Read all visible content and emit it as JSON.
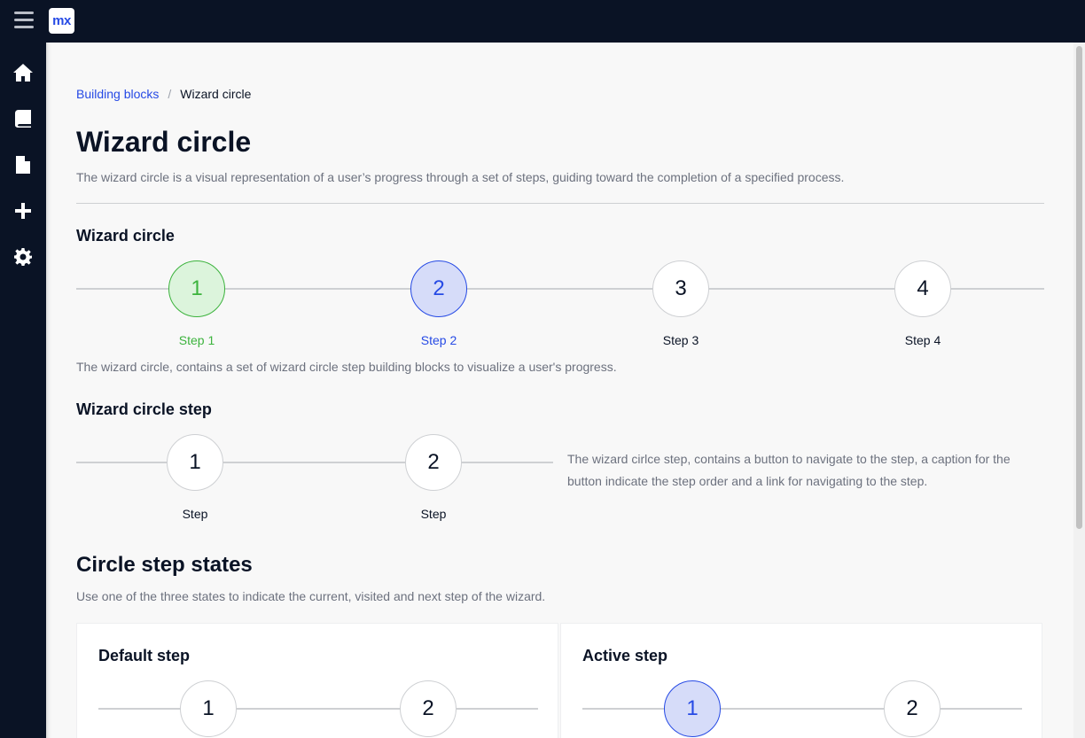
{
  "topbar": {
    "logo_text": "mx",
    "menu_icon": "hamburger-icon"
  },
  "sidebar": {
    "items": [
      {
        "name": "home",
        "icon": "home-icon"
      },
      {
        "name": "book",
        "icon": "book-icon"
      },
      {
        "name": "file",
        "icon": "file-icon"
      },
      {
        "name": "add",
        "icon": "plus-icon"
      },
      {
        "name": "settings",
        "icon": "gear-icon"
      }
    ]
  },
  "breadcrumb": {
    "link": "Building blocks",
    "separator": "/",
    "current": "Wizard circle"
  },
  "page": {
    "title": "Wizard circle",
    "description": "The wizard circle is a visual representation of a user’s progress through a set of steps, guiding toward the completion of a specified process."
  },
  "section_wizard": {
    "title": "Wizard circle",
    "steps": [
      {
        "number": "1",
        "caption": "Step 1",
        "state": "visited"
      },
      {
        "number": "2",
        "caption": "Step 2",
        "state": "active"
      },
      {
        "number": "3",
        "caption": "Step 3",
        "state": "default"
      },
      {
        "number": "4",
        "caption": "Step 4",
        "state": "default"
      }
    ],
    "description": "The wizard circle, contains a set of wizard circle step building blocks to visualize a user's progress."
  },
  "section_step": {
    "title": "Wizard circle step",
    "steps": [
      {
        "number": "1",
        "caption": "Step"
      },
      {
        "number": "2",
        "caption": "Step"
      }
    ],
    "description": "The wizard cirlce step, contains a button to navigate to the step, a caption for the button indicate the step order and a link for navigating to the step."
  },
  "section_states": {
    "title": "Circle step states",
    "description": "Use one of the three states to indicate the current, visited and next step of the wizard.",
    "cards": [
      {
        "title": "Default step",
        "steps": [
          "1",
          "2"
        ]
      },
      {
        "title": "Active step",
        "steps": [
          "1",
          "2"
        ]
      }
    ]
  },
  "colors": {
    "nav": "#0a1325",
    "brand": "#264ae5",
    "success": "#3cb33d",
    "muted_text": "#6c717e"
  }
}
